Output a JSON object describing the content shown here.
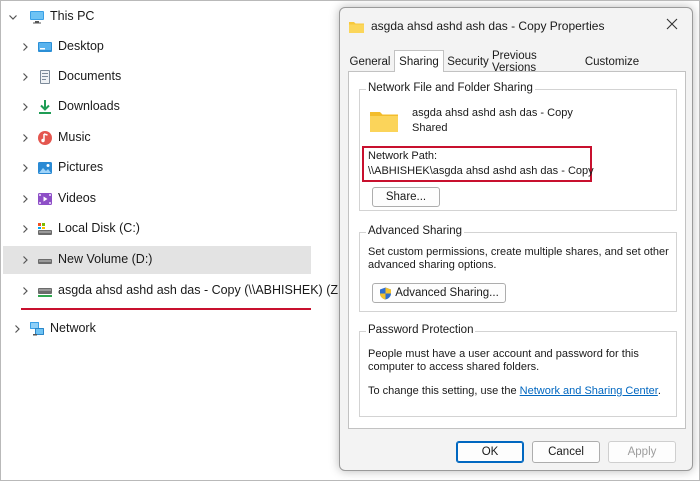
{
  "nav": {
    "items": [
      {
        "label": "This PC",
        "icon": "monitor-icon",
        "expanded": true
      },
      {
        "label": "Desktop",
        "icon": "desktop-icon"
      },
      {
        "label": "Documents",
        "icon": "documents-icon"
      },
      {
        "label": "Downloads",
        "icon": "download-icon"
      },
      {
        "label": "Music",
        "icon": "music-icon"
      },
      {
        "label": "Pictures",
        "icon": "pictures-icon"
      },
      {
        "label": "Videos",
        "icon": "videos-icon"
      },
      {
        "label": "Local Disk (C:)",
        "icon": "local-disk-icon"
      },
      {
        "label": "New Volume (D:)",
        "icon": "drive-icon",
        "selected": true
      },
      {
        "label": "asgda ahsd ashd ash das - Copy (\\\\ABHISHEK) (Z:)",
        "icon": "network-drive-icon"
      },
      {
        "label": "Network",
        "icon": "network-icon"
      }
    ]
  },
  "dialog": {
    "title": "asgda ahsd ashd ash das - Copy Properties",
    "tabs": [
      "General",
      "Sharing",
      "Security",
      "Previous Versions",
      "Customize"
    ],
    "active_tab": "Sharing",
    "network_sharing": {
      "group_title": "Network File and Folder Sharing",
      "folder_name": "asgda ahsd ashd ash das - Copy",
      "status": "Shared",
      "path_label": "Network Path:",
      "path_value": "\\\\ABHISHEK\\asgda ahsd ashd ash das - Copy",
      "share_button": "Share..."
    },
    "advanced_sharing": {
      "group_title": "Advanced Sharing",
      "description_line1": "Set custom permissions, create multiple shares, and set other",
      "description_line2": "advanced sharing options.",
      "button": "Advanced Sharing..."
    },
    "password_protection": {
      "group_title": "Password Protection",
      "line1": "People must have a user account and password for this",
      "line2": "computer to access shared folders.",
      "change_prefix": "To change this setting, use the ",
      "change_link": "Network and Sharing Center",
      "change_suffix": "."
    },
    "buttons": {
      "ok": "OK",
      "cancel": "Cancel",
      "apply": "Apply"
    }
  },
  "colors": {
    "highlight_red": "#c8102e",
    "accent_blue": "#0067c0",
    "selection_gray": "#e3e3e3"
  }
}
